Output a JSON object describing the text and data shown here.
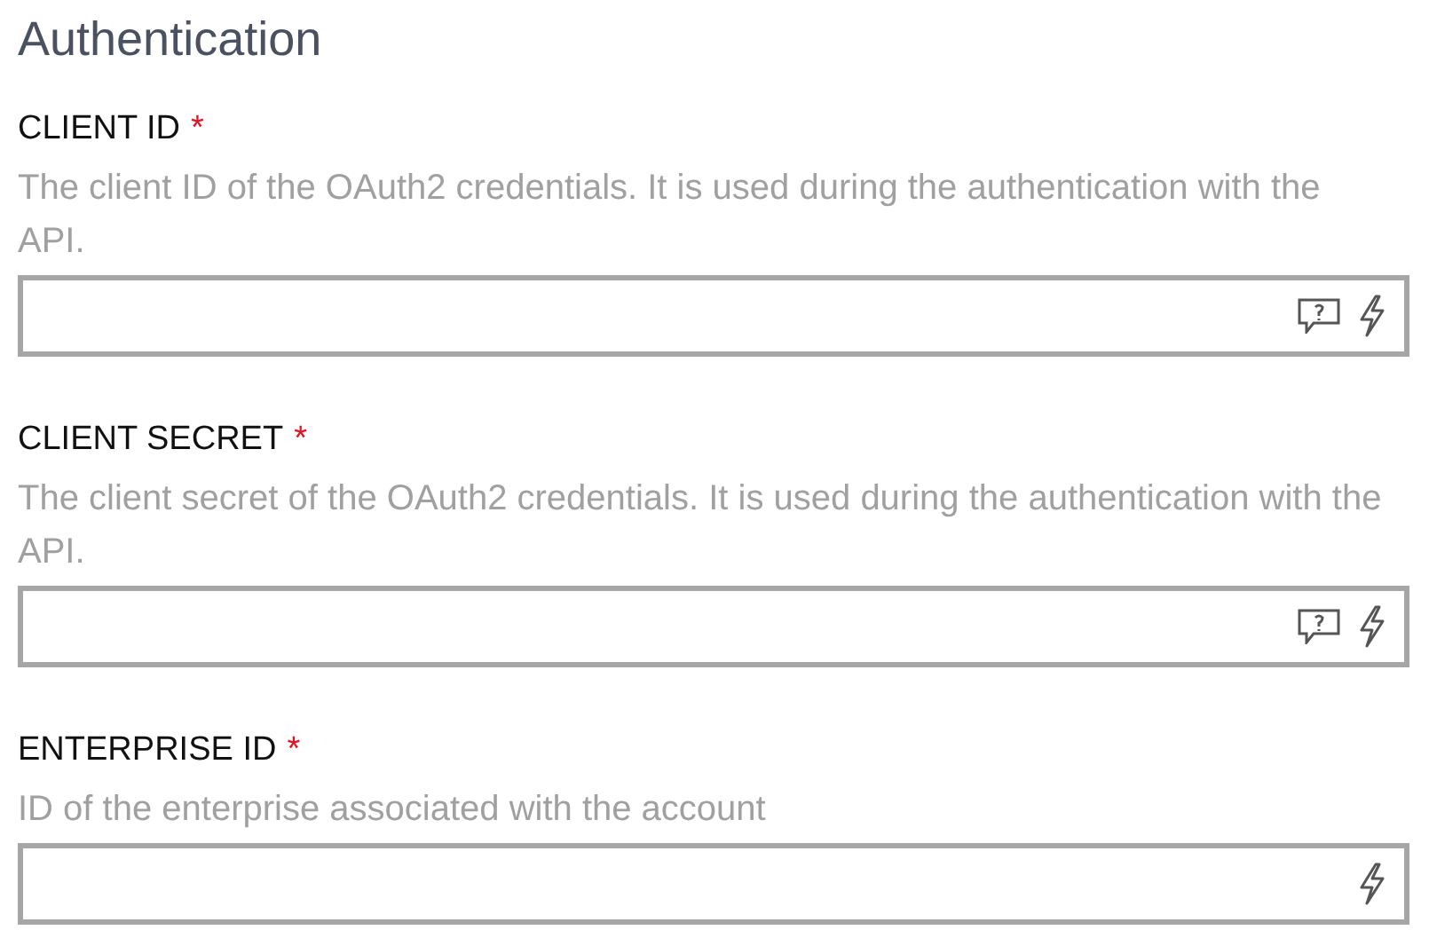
{
  "section": {
    "title": "Authentication"
  },
  "fields": [
    {
      "label": "CLIENT ID",
      "required_mark": "*",
      "description": "The client ID of the OAuth2 credentials. It is used during the authentication with the API.",
      "help_icon": true
    },
    {
      "label": "CLIENT SECRET",
      "required_mark": "*",
      "description": "The client secret of the OAuth2 credentials. It is used during the authentication with the API.",
      "help_icon": true
    },
    {
      "label": "ENTERPRISE ID",
      "required_mark": "*",
      "description": "ID of the enterprise associated with the account",
      "help_icon": false
    }
  ]
}
